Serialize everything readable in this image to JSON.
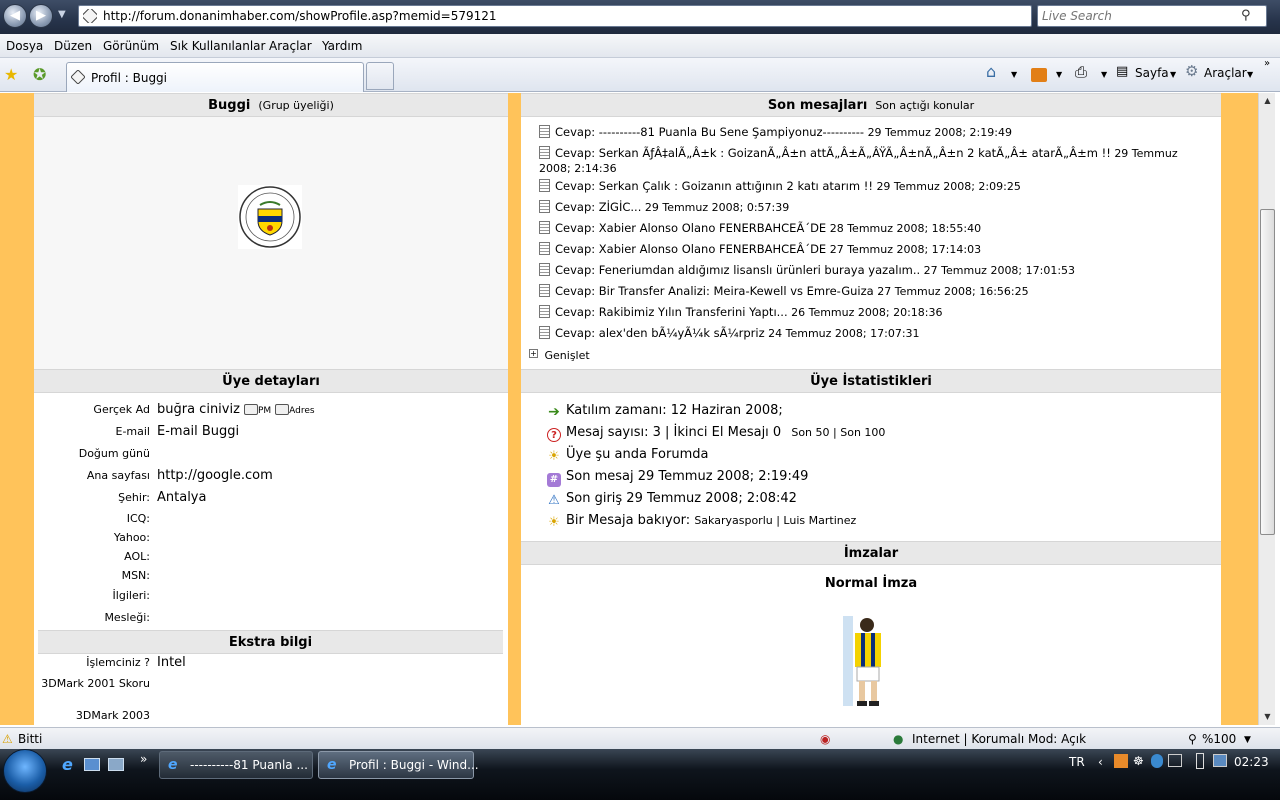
{
  "browser": {
    "url": "http://forum.donanimhaber.com/showProfile.asp?memid=579121",
    "search_placeholder": "Live Search",
    "menu": [
      "Dosya",
      "Düzen",
      "Görünüm",
      "Sık Kullanılanlar",
      "Araçlar",
      "Yardım"
    ],
    "tab_title": "Profil : Buggi",
    "commands": {
      "page": "Sayfa",
      "tools": "Araçlar"
    },
    "status_text": "Bitti",
    "zone_text": "Internet | Korumalı Mod: Açık",
    "zoom": "%100"
  },
  "profile": {
    "username": "Buggi",
    "group": "(Grup üyeliği)",
    "details_header": "Üye detayları",
    "fields": [
      {
        "label": "Gerçek Ad",
        "value": "buğra ciniviz"
      },
      {
        "label": "E-mail",
        "value": "E-mail Buggi"
      },
      {
        "label": "Doğum günü",
        "value": ""
      },
      {
        "label": "Ana sayfası",
        "value": "http://google.com"
      },
      {
        "label": "Şehir:",
        "value": "Antalya"
      },
      {
        "label": "ICQ:",
        "value": ""
      },
      {
        "label": "Yahoo:",
        "value": ""
      },
      {
        "label": "AOL:",
        "value": ""
      },
      {
        "label": "MSN:",
        "value": ""
      },
      {
        "label": "İlgileri:",
        "value": ""
      },
      {
        "label": "Mesleği:",
        "value": ""
      }
    ],
    "pm_label": "PM",
    "address_label": "Adres",
    "extra_header": "Ekstra bilgi",
    "extra_fields": [
      {
        "label": "İşlemciniz ?",
        "value": "Intel"
      },
      {
        "label": "3DMark 2001 Skoru",
        "value": ""
      },
      {
        "label": "3DMark 2003",
        "value": ""
      }
    ]
  },
  "messages": {
    "header": "Son mesajları",
    "subheader": "Son açtığı konular",
    "items": [
      {
        "title": "Cevap: ----------81 Puanla Bu Sene Şampiyonuz----------",
        "date": "29 Temmuz 2008; 2:19:49"
      },
      {
        "title": "Cevap: Serkan ÃƒÂ‡alÃ„Â±k : GoizanÃ„Â±n attÃ„Â±Ã„ÂŸÃ„Â±nÃ„Â±n 2 katÃ„Â± atarÃ„Â±m !!",
        "date": "29 Temmuz 2008; 2:14:36"
      },
      {
        "title": "Cevap: Serkan Çalık : Goizanın attığının 2 katı atarım !!",
        "date": "29 Temmuz 2008; 2:09:25"
      },
      {
        "title": "Cevap: ZİGİC...",
        "date": "29 Temmuz 2008; 0:57:39"
      },
      {
        "title": "Cevap: Xabier Alonso Olano FENERBAHCEÃ´DE",
        "date": "28 Temmuz 2008; 18:55:40"
      },
      {
        "title": "Cevap: Xabier Alonso Olano FENERBAHCEÂ´DE",
        "date": "27 Temmuz 2008; 17:14:03"
      },
      {
        "title": "Cevap: Feneriumdan aldığımız lisanslı ürünleri buraya yazalım..",
        "date": "27 Temmuz 2008; 17:01:53"
      },
      {
        "title": "Cevap: Bir Transfer Analizi: Meira-Kewell vs Emre-Guiza",
        "date": "27 Temmuz 2008; 16:56:25"
      },
      {
        "title": "Cevap: Rakibimiz Yılın Transferini Yaptı...",
        "date": "26 Temmuz 2008; 20:18:36"
      },
      {
        "title": "Cevap: alex'den bÃ¼yÃ¼k sÃ¼rpriz",
        "date": "24 Temmuz 2008; 17:07:31"
      }
    ],
    "expand_label": "Genişlet"
  },
  "stats": {
    "header": "Üye İstatistikleri",
    "joined": "Katılım zamanı: 12 Haziran 2008;",
    "msg_count": "Mesaj sayısı: 3 | İkinci El Mesajı 0",
    "last50": "Son 50",
    "last100": "Son 100",
    "online": "Üye şu anda Forumda",
    "last_msg": "Son mesaj 29 Temmuz 2008; 2:19:49",
    "last_login": "Son giriş 29 Temmuz 2008; 2:08:42",
    "viewing_label": "Bir Mesaja bakıyor:",
    "viewing_value": "Sakaryasporlu | Luis Martinez"
  },
  "signature": {
    "header": "İmzalar",
    "normal": "Normal İmza"
  },
  "taskbar": {
    "items": [
      "----------81 Puanla ...",
      "Profil : Buggi - Wind..."
    ],
    "lang": "TR",
    "clock": "02:23"
  }
}
